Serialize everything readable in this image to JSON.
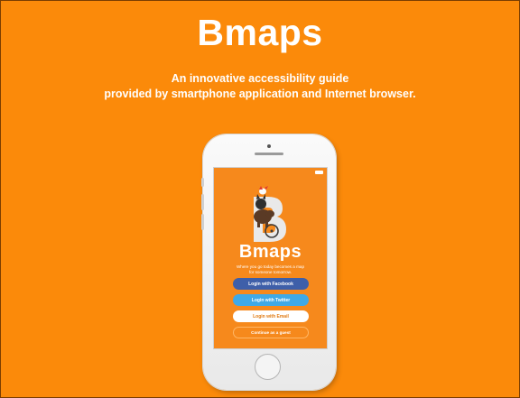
{
  "slide": {
    "title": "Bmaps",
    "subtitle_line1": "An innovative accessibility guide",
    "subtitle_line2": "provided by smartphone application and Internet browser."
  },
  "phone_screen": {
    "app_name": "Bmaps",
    "tagline_line1": "Where you go today becomes a map",
    "tagline_line2": "for someone tomorrow.",
    "buttons": {
      "facebook": "Login with Facebook",
      "twitter": "Login with Twitter",
      "email": "Login with Email",
      "guest": "Continue as a guest"
    }
  },
  "colors": {
    "background": "#fb8a0a",
    "facebook": "#3e5fa9",
    "twitter": "#3fa9e6",
    "email": "#ffffff"
  }
}
